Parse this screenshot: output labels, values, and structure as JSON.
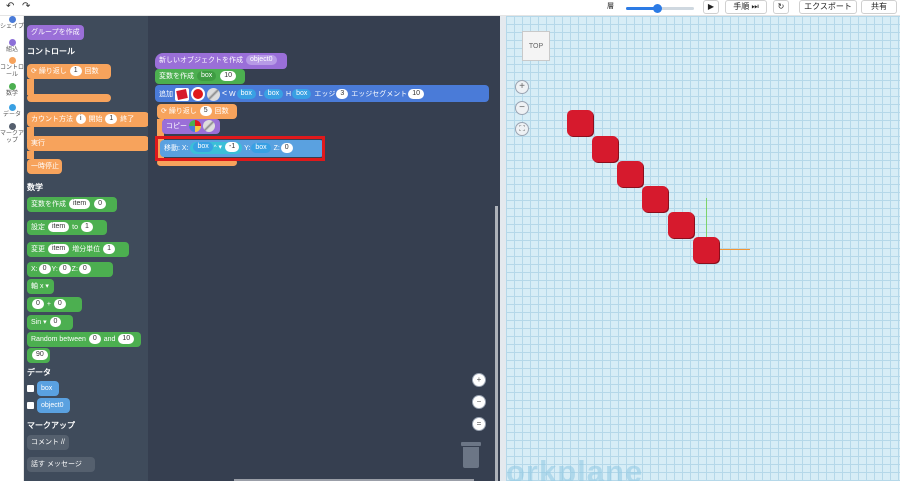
{
  "toolbar": {
    "back_icon": "undo-arrow-icon",
    "forward_icon": "redo-arrow-icon",
    "pace_label": "層",
    "pace_level": 0.45,
    "play_icon": "play-icon",
    "step_label": "手順",
    "reset_icon": "reset-icon",
    "export_label": "エクスポート",
    "share_label": "共有"
  },
  "rail": {
    "items": [
      {
        "label": "シェイプ",
        "color": "#4a7bd8"
      },
      {
        "label": "組込",
        "color": "#8c6fd8"
      },
      {
        "label": "コントロール",
        "color": "#f7a35c"
      },
      {
        "label": "数学",
        "color": "#4caf50"
      },
      {
        "label": "データ",
        "color": "#39a0e3"
      },
      {
        "label": "マークアップ",
        "color": "#555f6e"
      }
    ]
  },
  "palette": {
    "group_create": "グループを作成",
    "control_heading": "コントロール",
    "repeat": {
      "label": "繰り返し",
      "count": "1",
      "unit": "回数"
    },
    "count_with": {
      "label": "カウント方法",
      "var": "i",
      "start_label": "開始",
      "start": "1",
      "end_label": "終了"
    },
    "run_label": "実行",
    "pause_label": "一時停止",
    "math_heading": "数学",
    "create_var": {
      "label": "変数を作成",
      "var": "item",
      "value": "0"
    },
    "set_var": {
      "label": "設定",
      "var": "item",
      "to_label": "to",
      "value": "1"
    },
    "change_var": {
      "label": "変更",
      "var": "item",
      "by_label": "増分単位",
      "value": "1"
    },
    "xyz": {
      "x_label": "X:",
      "x": "0",
      "y_label": "Y:",
      "y": "0",
      "z_label": "Z:",
      "z": "0"
    },
    "axis_label": "軸 x",
    "arith": {
      "a": "0",
      "op": "+",
      "b": "0"
    },
    "sin": {
      "label": "Sin",
      "value": "0"
    },
    "random": {
      "label": "Random between",
      "a": "0",
      "and_label": "and",
      "b": "10"
    },
    "number": "90",
    "data_heading": "データ",
    "data_vars": [
      "box",
      "object0"
    ],
    "markup_heading": "マークアップ",
    "comment_label": "コメント //",
    "say": {
      "label": "話す",
      "text": "メッセージ"
    }
  },
  "workspace": {
    "create_object": {
      "label": "新しいオブジェクトを作成",
      "name": "object0"
    },
    "create_var": {
      "label": "変数を作成",
      "var": "box",
      "value": "10"
    },
    "add_shape": {
      "label": "追加",
      "w_label": "W",
      "w": "box",
      "l_label": "L",
      "l": "box",
      "h_label": "H",
      "h": "box",
      "edge_label": "エッジ",
      "edge": "3",
      "segment_label": "エッジセグメント",
      "segment": "10"
    },
    "repeat": {
      "label": "繰り返し",
      "count": "5",
      "unit": "回数"
    },
    "copy_label": "コピー",
    "move": {
      "label": "移動:",
      "x_label": "X:",
      "x_var": "box",
      "op": "^",
      "x_val": "-1",
      "y_label": "Y:",
      "y": "box",
      "z_label": "Z:",
      "z": "0"
    },
    "zoom_in_icon": "zoom-in-icon",
    "zoom_out_icon": "zoom-out-icon",
    "reset_zoom_icon": "equals-icon",
    "trash_icon": "trash-icon"
  },
  "viewport": {
    "viewcube_label": "TOP",
    "plus_icon": "plus-icon",
    "minus_icon": "minus-icon",
    "fit_icon": "fit-icon",
    "workplane_label": "orkplane",
    "shape_color": "#d61a2d"
  }
}
